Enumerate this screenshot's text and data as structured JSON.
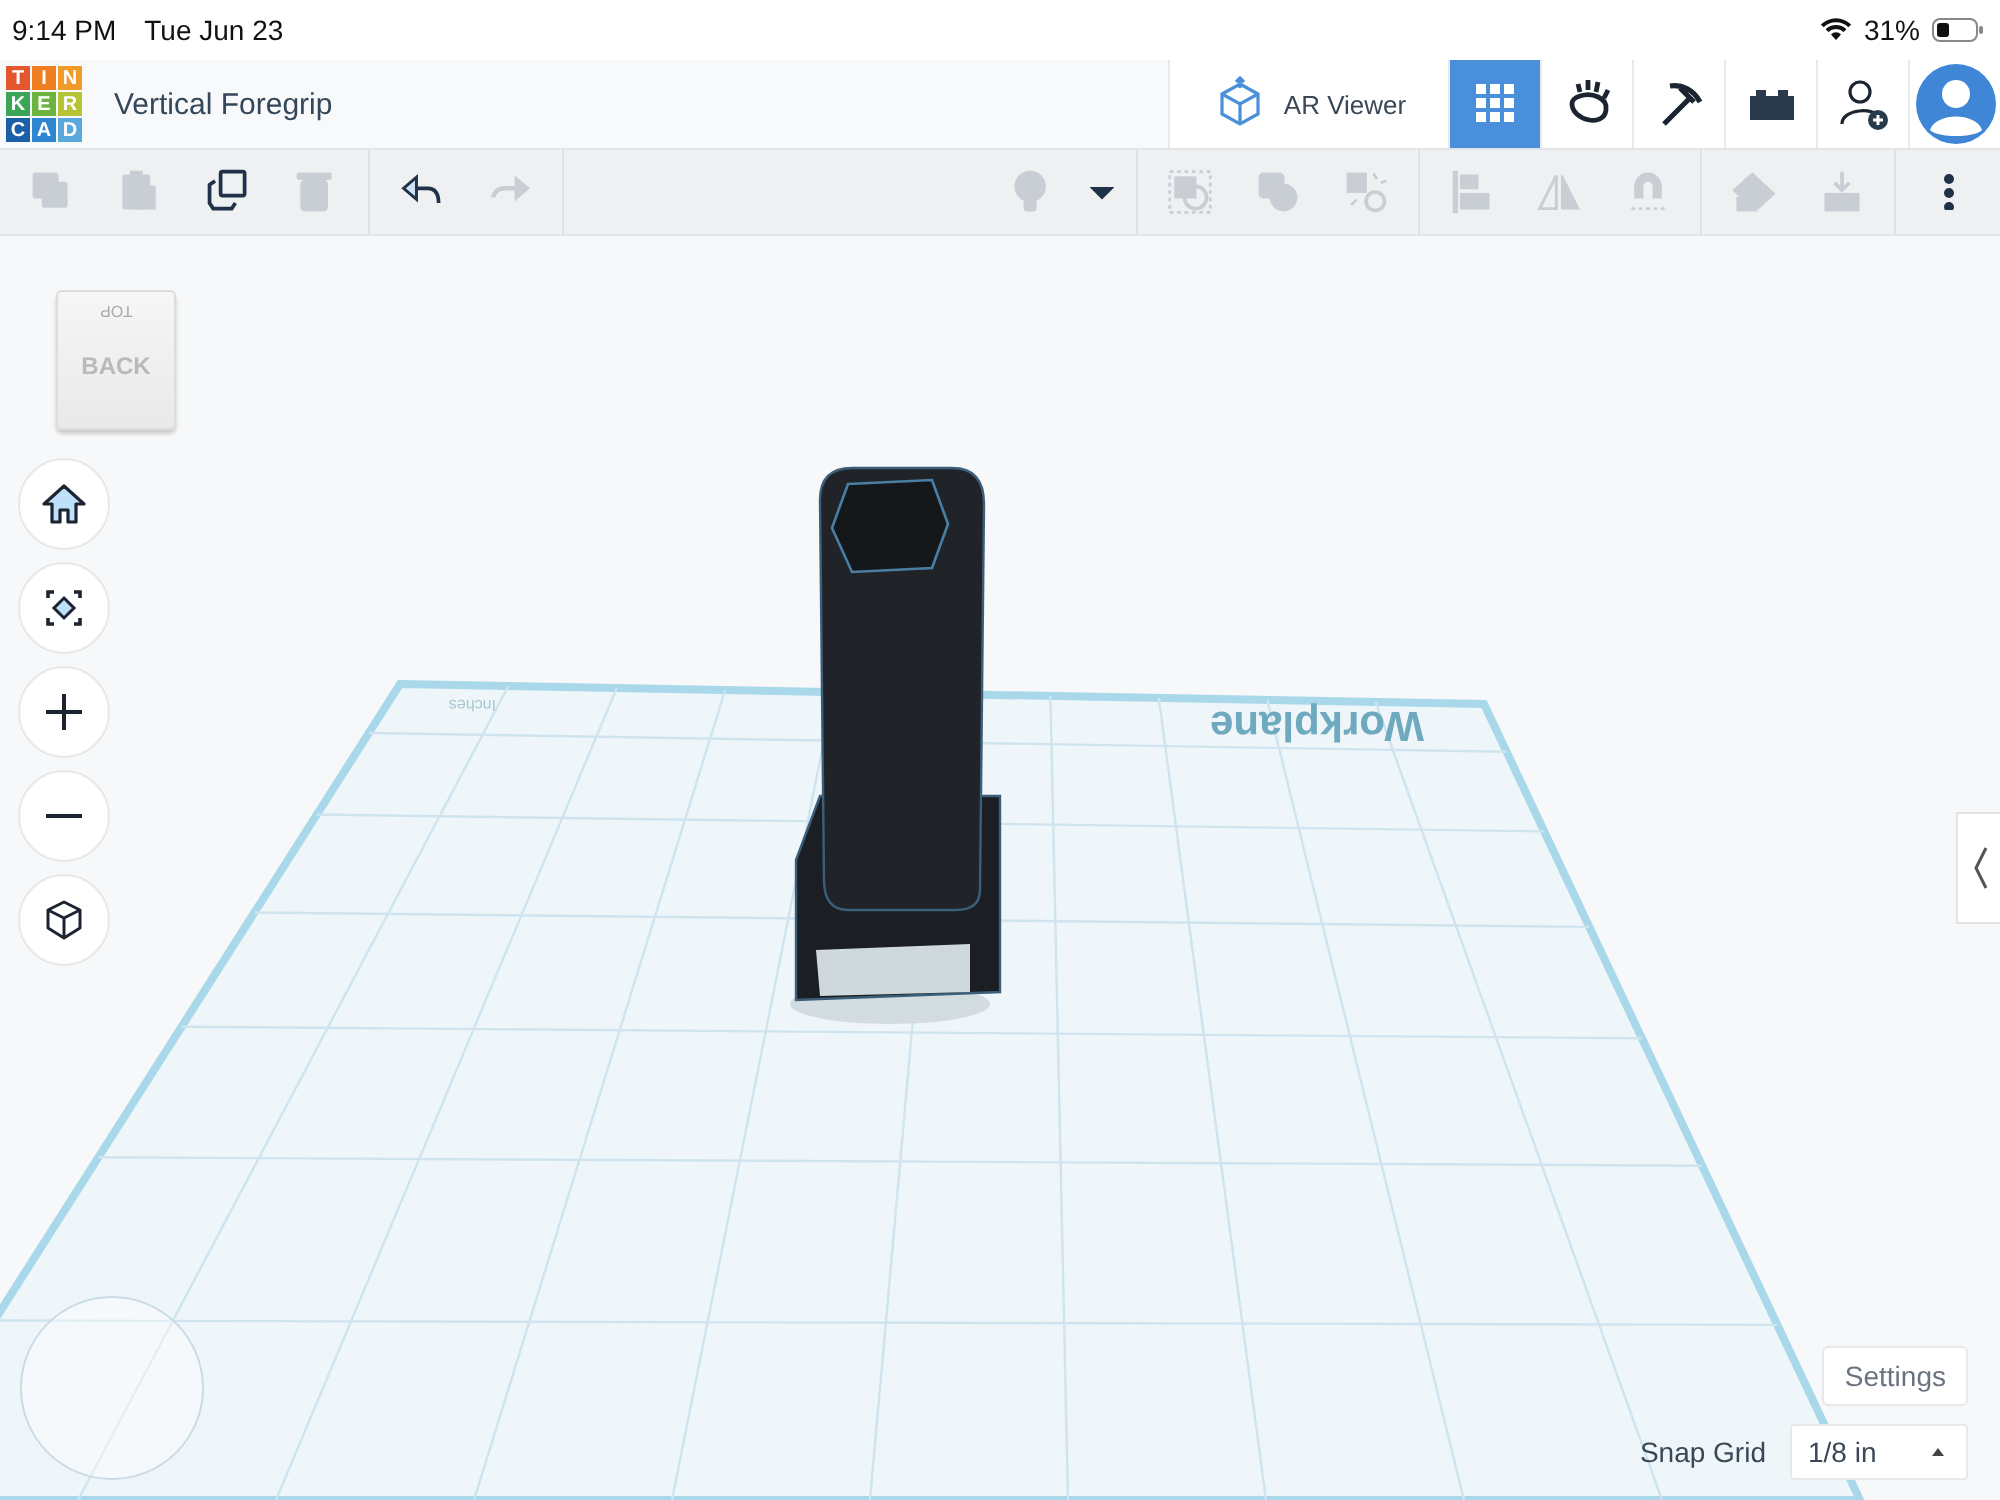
{
  "status_bar": {
    "time": "9:14 PM",
    "date": "Tue Jun 23",
    "battery": "31%"
  },
  "logo": [
    {
      "letter": "T",
      "color": "#e4572e"
    },
    {
      "letter": "I",
      "color": "#ef7d22"
    },
    {
      "letter": "N",
      "color": "#f09a2a"
    },
    {
      "letter": "K",
      "color": "#3aa655"
    },
    {
      "letter": "E",
      "color": "#6cb33f"
    },
    {
      "letter": "R",
      "color": "#b6c334"
    },
    {
      "letter": "C",
      "color": "#1a5fa8"
    },
    {
      "letter": "A",
      "color": "#2f86d0"
    },
    {
      "letter": "D",
      "color": "#5aa9dc"
    }
  ],
  "title": "Vertical Foregrip",
  "header_buttons": [
    {
      "kind": "ar",
      "label": "AR Viewer",
      "selected": false
    },
    {
      "kind": "grid",
      "selected": true
    },
    {
      "kind": "hand",
      "selected": false
    },
    {
      "kind": "pickaxe",
      "selected": false
    },
    {
      "kind": "brick",
      "selected": false
    },
    {
      "kind": "add-user",
      "selected": false
    },
    {
      "kind": "avatar",
      "selected": false
    }
  ],
  "toolbar_left": [
    [
      {
        "kind": "copy",
        "disabled": true
      },
      {
        "kind": "paste",
        "disabled": true
      },
      {
        "kind": "duplicate",
        "disabled": false
      },
      {
        "kind": "delete",
        "disabled": true
      }
    ],
    [
      {
        "kind": "undo",
        "disabled": false
      },
      {
        "kind": "redo",
        "disabled": true
      }
    ]
  ],
  "toolbar_right": [
    [
      {
        "kind": "bulb",
        "disabled": true
      },
      {
        "kind": "caret",
        "disabled": false
      }
    ],
    [
      {
        "kind": "group",
        "disabled": true
      },
      {
        "kind": "solid",
        "disabled": true
      },
      {
        "kind": "ungroup",
        "disabled": true
      }
    ],
    [
      {
        "kind": "align",
        "disabled": true
      },
      {
        "kind": "mirror",
        "disabled": true
      },
      {
        "kind": "magnet",
        "disabled": true
      }
    ],
    [
      {
        "kind": "ruler",
        "disabled": true
      },
      {
        "kind": "import",
        "disabled": true
      }
    ],
    [
      {
        "kind": "more",
        "disabled": false
      }
    ]
  ],
  "view_cube": {
    "top": "TOP",
    "side": "BACK"
  },
  "nav_buttons": [
    {
      "kind": "home"
    },
    {
      "kind": "fit"
    },
    {
      "kind": "zoom-in"
    },
    {
      "kind": "zoom-out"
    },
    {
      "kind": "ortho"
    }
  ],
  "workplane": {
    "label": "Workplane",
    "units": "Inches"
  },
  "settings_button": "Settings",
  "snap_grid": {
    "label": "Snap Grid",
    "value": "1/8 in"
  }
}
